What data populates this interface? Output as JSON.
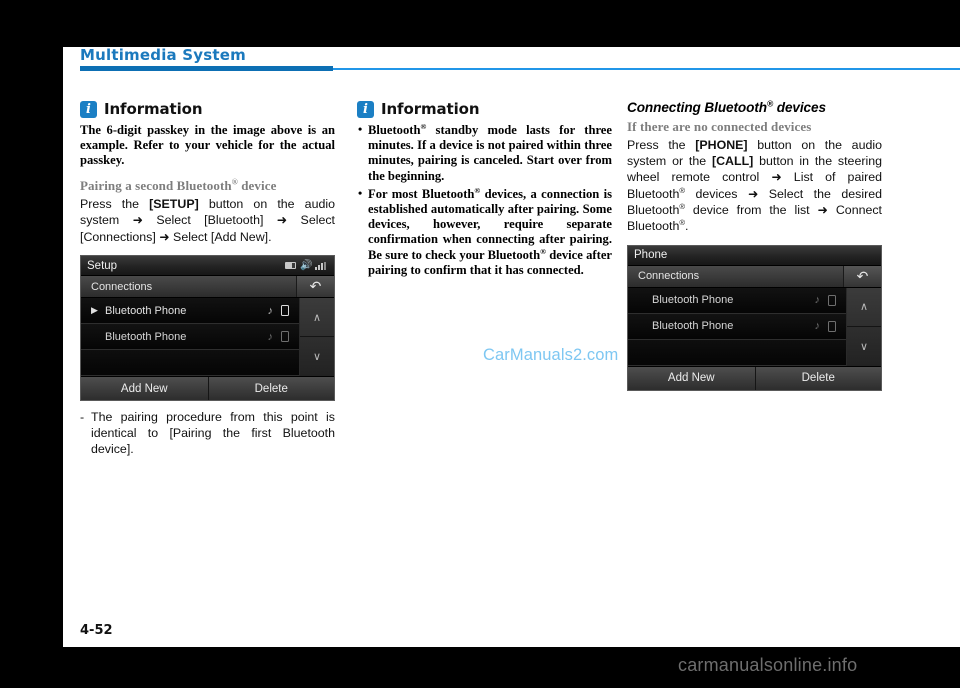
{
  "page": {
    "running_head": "Multimedia System",
    "folio": "4-52",
    "watermark_inline": "CarManuals2.com",
    "watermark_bottom": "carmanualsonline.info",
    "accent_color": "#0d6fb4",
    "accent_light": "#2196e8",
    "info_badge_color": "#1b7fc4"
  },
  "col1": {
    "info": {
      "badge": "i",
      "title": "Information",
      "paragraph": "The 6-digit passkey in the image above is an example. Refer to your vehicle for the actual passkey."
    },
    "subhead_prefix": "Pairing a second Bluetooth",
    "subhead_reg": "®",
    "subhead_suffix": " device",
    "body": {
      "t1": "Press the ",
      "b1": "[SETUP]",
      "t2": " button on the audio system ",
      "a1": "➜",
      "t3": " Select [Bluetooth] ",
      "a2": "➜",
      "t4": " Select [Connections] ",
      "a3": "➜",
      "t5": " Select [Add New]."
    },
    "screenshot": {
      "title": "Setup",
      "subtitle": "Connections",
      "back_icon": "↶",
      "status_icons": [
        "sd-card-icon",
        "volume-icon",
        "signal-icon"
      ],
      "rows": [
        {
          "label": "Bluetooth Phone",
          "selected": true
        },
        {
          "label": "Bluetooth Phone",
          "selected": false
        },
        {
          "label": "",
          "selected": false
        }
      ],
      "scroll_up": "∧",
      "scroll_down": "∨",
      "footer_buttons": [
        "Add New",
        "Delete"
      ]
    },
    "note": "The pairing procedure from this point is identical to [Pairing the first Bluetooth device]."
  },
  "col2": {
    "info": {
      "badge": "i",
      "title": "Information"
    },
    "bullets": [
      {
        "p1": "Bluetooth",
        "reg": "®",
        "p2": " standby mode lasts for three minutes. If a device is not paired within three minutes, pairing is canceled. Start over from the beginning."
      },
      {
        "p1": "For most Bluetooth",
        "reg": "®",
        "p2": " devices, a connection is established automatically after pairing. Some devices, however, require separate confirmation when connecting after pairing. Be sure to check your Bluetooth",
        "reg2": "®",
        "p3": " device after pairing to confirm that it has connected."
      }
    ]
  },
  "col3": {
    "section_head_prefix": "Connecting Bluetooth",
    "section_head_reg": "®",
    "section_head_suffix": " devices",
    "subhead": "If there are no connected devices",
    "body": {
      "t1": "Press the ",
      "b1": "[PHONE]",
      "t2": " button on the audio system or the ",
      "b2": "[CALL]",
      "t3": " button in the steering wheel remote control ",
      "a1": "➜",
      "t4": " List of paired Bluetooth",
      "r1": "®",
      "t5": " devices ",
      "a2": "➜",
      "t6": " Select the desired Bluetooth",
      "r2": "®",
      "t7": " device from the list ",
      "a3": "➜",
      "t8": " Connect Bluetooth",
      "r3": "®",
      "t9": "."
    },
    "screenshot": {
      "title": "Phone",
      "subtitle": "Connections",
      "back_icon": "↶",
      "status_icons": [],
      "rows": [
        {
          "label": "Bluetooth Phone",
          "selected": false
        },
        {
          "label": "Bluetooth Phone",
          "selected": false
        },
        {
          "label": "",
          "selected": false
        }
      ],
      "scroll_up": "∧",
      "scroll_down": "∨",
      "footer_buttons": [
        "Add New",
        "Delete"
      ]
    }
  }
}
